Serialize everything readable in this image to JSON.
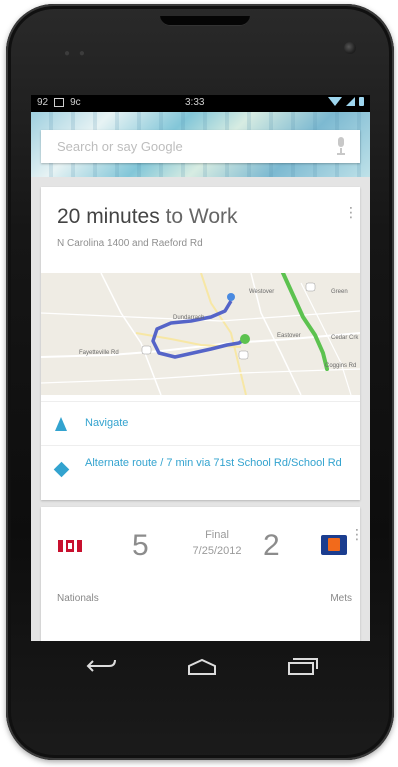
{
  "status_bar": {
    "left_indicators": [
      "92",
      "9c"
    ],
    "time": "3:33"
  },
  "search": {
    "placeholder": "Search or say Google"
  },
  "traffic_card": {
    "title_number": "20 minutes",
    "title_rest": " to Work",
    "subtitle": "N Carolina 1400 and Raeford Rd",
    "map_labels": {
      "label1": "Westover",
      "label2": "Green",
      "label3": "Dundarrach",
      "label4": "Fayetteville Rd",
      "label5": "Cedar Crk",
      "label6": "Coggins Rd",
      "label7": "Eastover"
    },
    "navigate_label": "Navigate",
    "alternate_route_label": "Alternate route / 7 min via 71st School Rd/School Rd"
  },
  "score_card": {
    "home_score": "5",
    "away_score": "2",
    "status": "Final",
    "date": "7/25/2012",
    "left_team": "Nationals",
    "right_team": "Mets"
  },
  "colors": {
    "accent": "#33a3cf",
    "route_blue": "#5564c8",
    "highway_green": "#5cc24f"
  }
}
